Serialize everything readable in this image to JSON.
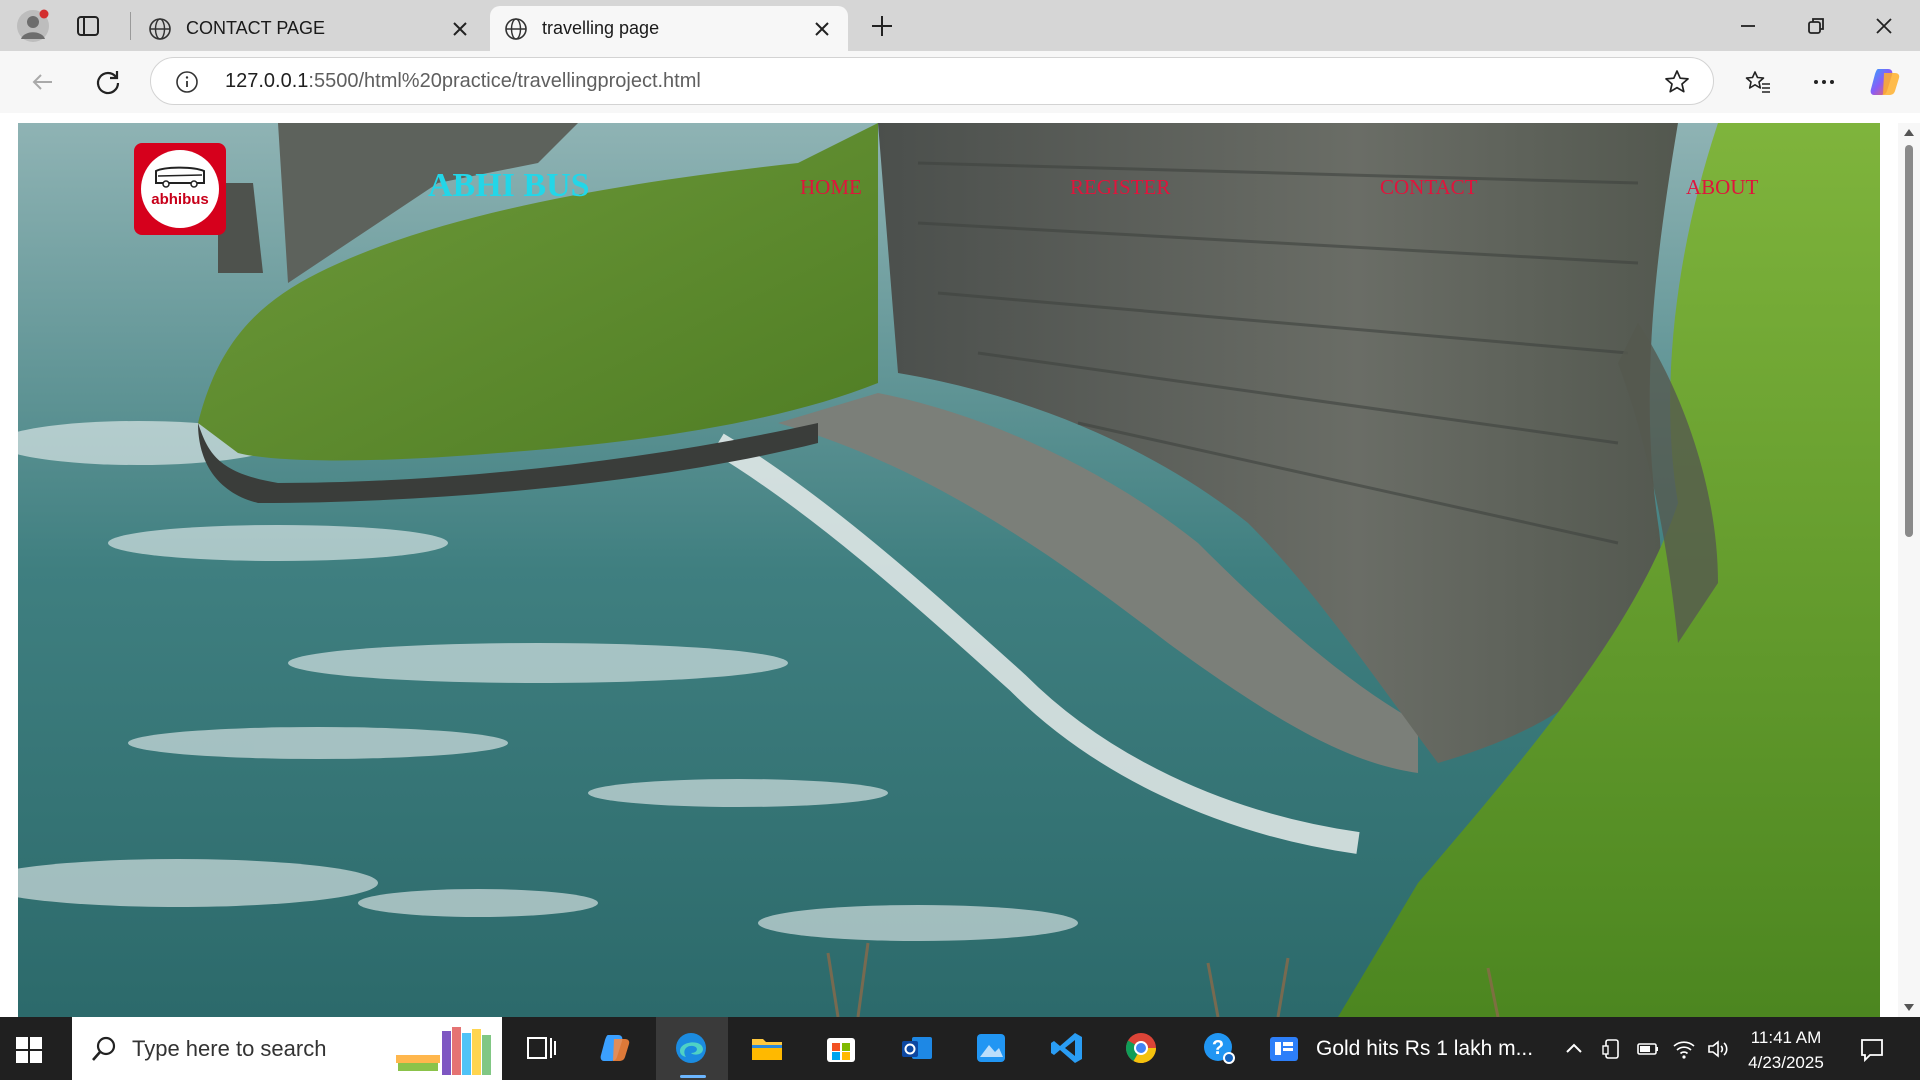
{
  "browser": {
    "tabs": [
      {
        "title": "CONTACT PAGE",
        "active": false
      },
      {
        "title": "travelling page",
        "active": true
      }
    ],
    "address": {
      "host": "127.0.0.1",
      "path": ":5500/html%20practice/travellingproject.html"
    }
  },
  "site": {
    "logo_text": "abhibus",
    "brand": "ABHI BUS",
    "menu": [
      "HOME",
      "REGISTER",
      "CONTACT",
      "ABOUT"
    ],
    "brand_color": "#23d6e8",
    "menu_color": "#e0143c",
    "logo_color": "#d6001c"
  },
  "taskbar": {
    "search_placeholder": "Type here to search",
    "news": "Gold hits Rs 1 lakh m...",
    "time": "11:41 AM",
    "date": "4/23/2025"
  }
}
